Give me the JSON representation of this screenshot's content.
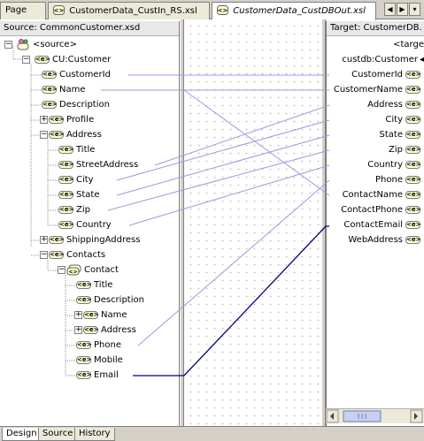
{
  "tabs": {
    "items": [
      {
        "label": "Page"
      },
      {
        "label": "CustomerData_CustIn_RS.xsl"
      },
      {
        "label": "CustomerData_CustDBOut.xsl"
      }
    ],
    "nav": {
      "prev": "◀",
      "next": "▶",
      "menu": "▾"
    }
  },
  "source": {
    "header": "Source: CommonCustomer.xsd",
    "root": "<source>",
    "nodes": [
      {
        "label": "CU:Customer",
        "expander": "−"
      },
      {
        "label": "CustomerId"
      },
      {
        "label": "Name"
      },
      {
        "label": "Description"
      },
      {
        "label": "Profile",
        "expander": "+"
      },
      {
        "label": "Address",
        "expander": "−"
      },
      {
        "label": "Title"
      },
      {
        "label": "StreetAddress"
      },
      {
        "label": "City"
      },
      {
        "label": "State"
      },
      {
        "label": "Zip"
      },
      {
        "label": "Country"
      },
      {
        "label": "ShippingAddress",
        "expander": "+"
      },
      {
        "label": "Contacts",
        "expander": "−"
      },
      {
        "label": "Contact",
        "expander": "−"
      },
      {
        "label": "Title"
      },
      {
        "label": "Description"
      },
      {
        "label": "Name",
        "expander": "+"
      },
      {
        "label": "Address",
        "expander": "+"
      },
      {
        "label": "Phone"
      },
      {
        "label": "Mobile"
      },
      {
        "label": "Email"
      }
    ]
  },
  "target": {
    "header": "Target: CustomerDB.",
    "root": "<targe",
    "nodes": [
      {
        "label": "custdb:Customer"
      },
      {
        "label": "CustomerId"
      },
      {
        "label": "CustomerName"
      },
      {
        "label": "Address"
      },
      {
        "label": "City"
      },
      {
        "label": "State"
      },
      {
        "label": "Zip"
      },
      {
        "label": "Country"
      },
      {
        "label": "Phone"
      },
      {
        "label": "ContactName"
      },
      {
        "label": "ContactPhone"
      },
      {
        "label": "ContactEmail"
      },
      {
        "label": "WebAddress"
      }
    ]
  },
  "node_badge": "<e>",
  "colors": {
    "link": "#9a9ae0",
    "selected_link": "#000080",
    "panel": "#d4d0c8"
  },
  "bottom_tabs": [
    {
      "label": "Design"
    },
    {
      "label": "Source"
    },
    {
      "label": "History"
    }
  ]
}
